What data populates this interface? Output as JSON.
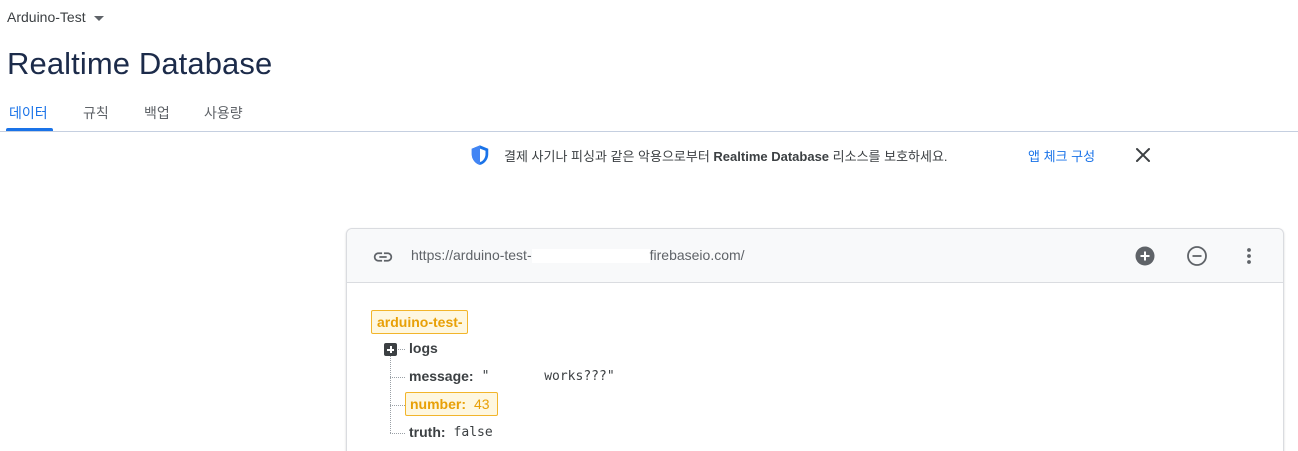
{
  "project": {
    "name": "Arduino-Test"
  },
  "page": {
    "title": "Realtime Database"
  },
  "tabs": [
    {
      "label": "데이터",
      "active": true
    },
    {
      "label": "규칙"
    },
    {
      "label": "백업"
    },
    {
      "label": "사용량"
    }
  ],
  "banner": {
    "text_before": "결제 사기나 피싱과 같은 악용으로부터 ",
    "text_bold": "Realtime Database",
    "text_after": " 리소스를 보호하세요.",
    "action_label": "앱 체크 구성",
    "icon": "shield-icon",
    "close_icon": "close-icon"
  },
  "database": {
    "url_prefix": "https://arduino-test-",
    "url_suffix": "firebaseio.com/",
    "header_icons": [
      "link-icon",
      "add-circle-icon",
      "remove-circle-icon",
      "more-vert-icon"
    ],
    "root": "arduino-test-",
    "nodes": [
      {
        "key": "logs",
        "value": ""
      },
      {
        "key": "message:",
        "value": "\"       works???\""
      },
      {
        "key": "number:",
        "value": "43"
      },
      {
        "key": "truth:",
        "value": "false"
      }
    ]
  },
  "colors": {
    "accent": "#1a73e8",
    "highlight_border": "#f2b52b",
    "highlight_text": "#e8a007",
    "title": "#1c2b4a"
  }
}
